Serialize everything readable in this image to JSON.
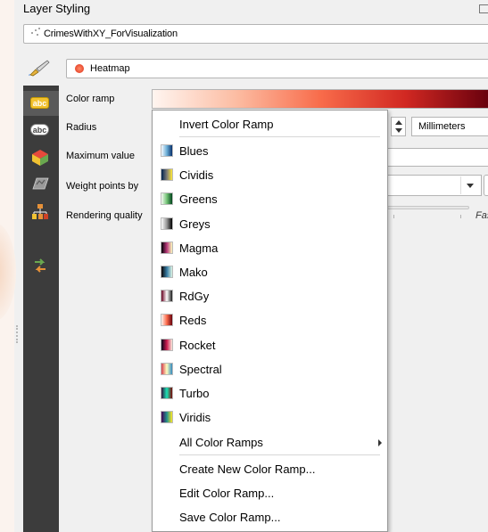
{
  "panel": {
    "title": "Layer Styling"
  },
  "layer_combo": {
    "value": "CrimesWithXY_ForVisualization"
  },
  "renderer_combo": {
    "value": "Heatmap"
  },
  "properties": {
    "color_ramp": "Color ramp",
    "radius": "Radius",
    "maximum_value": "Maximum value",
    "weight_points_by": "Weight points by",
    "rendering_quality": "Rendering quality"
  },
  "radius_unit": "Millimeters",
  "quality_slider": {
    "fast_label": "Fas"
  },
  "sidebar_icons": [
    "labels-icon",
    "labels-alt-icon",
    "3d-view-icon",
    "diagram-icon",
    "rendering-icon",
    "history-icon"
  ],
  "menu": {
    "invert": "Invert Color Ramp",
    "ramps": [
      {
        "label": "Blues",
        "colors": [
          "#f7fbff",
          "#6baed6",
          "#08306b"
        ]
      },
      {
        "label": "Cividis",
        "colors": [
          "#00224e",
          "#7c7b78",
          "#fee838"
        ]
      },
      {
        "label": "Greens",
        "colors": [
          "#f7fcf5",
          "#74c476",
          "#00441b"
        ]
      },
      {
        "label": "Greys",
        "colors": [
          "#ffffff",
          "#969696",
          "#000000"
        ]
      },
      {
        "label": "Magma",
        "colors": [
          "#000004",
          "#b73779",
          "#fcfdbf"
        ]
      },
      {
        "label": "Mako",
        "colors": [
          "#0b0405",
          "#357ba2",
          "#def5e5"
        ]
      },
      {
        "label": "RdGy",
        "colors": [
          "#67001f",
          "#ffffff",
          "#1a1a1a"
        ]
      },
      {
        "label": "Reds",
        "colors": [
          "#fff5f0",
          "#fb6a4a",
          "#67000d"
        ]
      },
      {
        "label": "Rocket",
        "colors": [
          "#03051a",
          "#cb1b4f",
          "#faebdd"
        ]
      },
      {
        "label": "Spectral",
        "colors": [
          "#d53e4f",
          "#ffffbf",
          "#3288bd"
        ]
      },
      {
        "label": "Turbo",
        "colors": [
          "#30123b",
          "#1ae4b6",
          "#7a0403"
        ]
      },
      {
        "label": "Viridis",
        "colors": [
          "#440154",
          "#21918c",
          "#fde725"
        ]
      }
    ],
    "all_ramps": "All Color Ramps",
    "create": "Create New Color Ramp...",
    "edit": "Edit Color Ramp...",
    "save": "Save Color Ramp..."
  }
}
